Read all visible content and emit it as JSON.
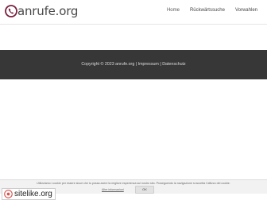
{
  "site": {
    "logo_text": "anrufe.org"
  },
  "nav": {
    "items": [
      {
        "label": "Home"
      },
      {
        "label": "Rückwärtssuche"
      },
      {
        "label": "Vorwahlen"
      }
    ]
  },
  "footer": {
    "copyright": "Copyright © 2023 anrufe.org",
    "separator": "|",
    "impressum": "Impressum",
    "datenschutz": "Datenschutz"
  },
  "cookie": {
    "text": "Utilizziamo i cookie per essere sicuri che tu possa avere la migliore esperienza sul nostro sito. Proseguendo la navigazione si accetta l'utilizzo dei cookie.",
    "link": "Altre informazioni",
    "ok": "OK"
  },
  "badge": {
    "text": "sitelike.org"
  },
  "colors": {
    "brand": "#7a1f3d",
    "footer_bg": "#373737"
  }
}
